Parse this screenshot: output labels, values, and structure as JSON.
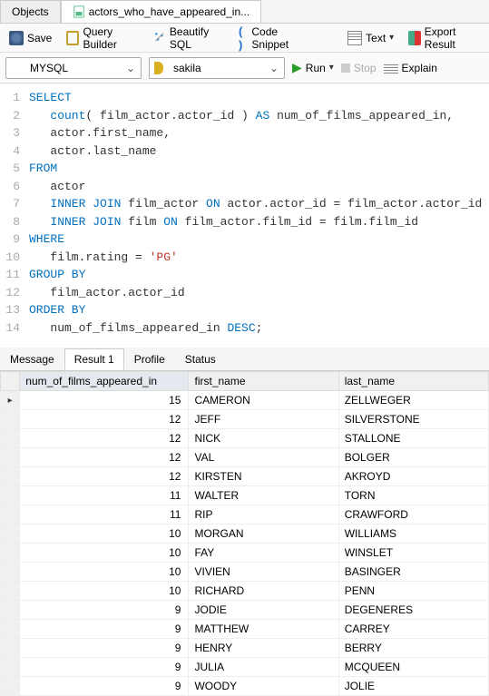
{
  "topTabs": {
    "objects": "Objects",
    "query": "actors_who_have_appeared_in..."
  },
  "toolbar": {
    "save": "Save",
    "queryBuilder": "Query Builder",
    "beautify": "Beautify SQL",
    "codeSnippet": "Code Snippet",
    "text": "Text",
    "export": "Export Result"
  },
  "toolbar2": {
    "engine": "MYSQL",
    "database": "sakila",
    "run": "Run",
    "stop": "Stop",
    "explain": "Explain"
  },
  "sql": {
    "lines": [
      {
        "n": 1,
        "t": "SELECT",
        "cls": "kw"
      },
      {
        "n": 2,
        "pre": "   ",
        "seg": [
          {
            "t": "count",
            "cls": "fn"
          },
          {
            "t": "( film_actor.actor_id ) "
          },
          {
            "t": "AS",
            "cls": "kw"
          },
          {
            "t": " num_of_films_appeared_in,"
          }
        ]
      },
      {
        "n": 3,
        "pre": "   ",
        "seg": [
          {
            "t": "actor.first_name,"
          }
        ]
      },
      {
        "n": 4,
        "pre": "   ",
        "seg": [
          {
            "t": "actor.last_name"
          }
        ]
      },
      {
        "n": 5,
        "seg": [
          {
            "t": "FROM",
            "cls": "kw"
          }
        ]
      },
      {
        "n": 6,
        "pre": "   ",
        "seg": [
          {
            "t": "actor"
          }
        ]
      },
      {
        "n": 7,
        "pre": "   ",
        "seg": [
          {
            "t": "INNER JOIN",
            "cls": "kw"
          },
          {
            "t": " film_actor "
          },
          {
            "t": "ON",
            "cls": "kw"
          },
          {
            "t": " actor.actor_id = film_actor.actor_id"
          }
        ]
      },
      {
        "n": 8,
        "pre": "   ",
        "seg": [
          {
            "t": "INNER JOIN",
            "cls": "kw"
          },
          {
            "t": " film "
          },
          {
            "t": "ON",
            "cls": "kw"
          },
          {
            "t": " film_actor.film_id = film.film_id"
          }
        ]
      },
      {
        "n": 9,
        "seg": [
          {
            "t": "WHERE",
            "cls": "kw"
          }
        ]
      },
      {
        "n": 10,
        "pre": "   ",
        "seg": [
          {
            "t": "film.rating = "
          },
          {
            "t": "'PG'",
            "cls": "str"
          }
        ]
      },
      {
        "n": 11,
        "seg": [
          {
            "t": "GROUP BY",
            "cls": "kw"
          }
        ]
      },
      {
        "n": 12,
        "pre": "   ",
        "seg": [
          {
            "t": "film_actor.actor_id"
          }
        ]
      },
      {
        "n": 13,
        "seg": [
          {
            "t": "ORDER BY",
            "cls": "kw"
          }
        ]
      },
      {
        "n": 14,
        "pre": "   ",
        "seg": [
          {
            "t": "num_of_films_appeared_in "
          },
          {
            "t": "DESC",
            "cls": "kw"
          },
          {
            "t": ";"
          }
        ]
      }
    ]
  },
  "midTabs": {
    "message": "Message",
    "result": "Result 1",
    "profile": "Profile",
    "status": "Status"
  },
  "grid": {
    "columns": [
      "num_of_films_appeared_in",
      "first_name",
      "last_name"
    ],
    "rows": [
      [
        15,
        "CAMERON",
        "ZELLWEGER"
      ],
      [
        12,
        "JEFF",
        "SILVERSTONE"
      ],
      [
        12,
        "NICK",
        "STALLONE"
      ],
      [
        12,
        "VAL",
        "BOLGER"
      ],
      [
        12,
        "KIRSTEN",
        "AKROYD"
      ],
      [
        11,
        "WALTER",
        "TORN"
      ],
      [
        11,
        "RIP",
        "CRAWFORD"
      ],
      [
        10,
        "MORGAN",
        "WILLIAMS"
      ],
      [
        10,
        "FAY",
        "WINSLET"
      ],
      [
        10,
        "VIVIEN",
        "BASINGER"
      ],
      [
        10,
        "RICHARD",
        "PENN"
      ],
      [
        9,
        "JODIE",
        "DEGENERES"
      ],
      [
        9,
        "MATTHEW",
        "CARREY"
      ],
      [
        9,
        "HENRY",
        "BERRY"
      ],
      [
        9,
        "JULIA",
        "MCQUEEN"
      ],
      [
        9,
        "WOODY",
        "JOLIE"
      ]
    ]
  }
}
